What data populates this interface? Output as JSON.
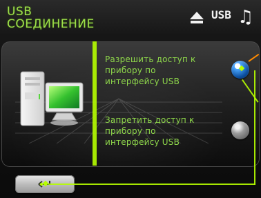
{
  "header": {
    "title_line1": "USB",
    "title_line2": "СОЕДИНЕНИЕ",
    "icons": [
      "eject-icon",
      "usb-icon",
      "music-note-icon"
    ],
    "usb_label": "USB"
  },
  "main": {
    "options": [
      {
        "label": "Разрешить доступ к прибору по интерфейсу USB",
        "lines": [
          "Разрешить доступ к",
          "прибору по",
          "интерфейсу USB"
        ],
        "selected": true
      },
      {
        "label": "Запретить доступ к прибору по интерфейсу USB",
        "lines": [
          "Запретить доступ к",
          "прибору по",
          "интерфейсу USB"
        ],
        "selected": false
      }
    ]
  },
  "footer": {
    "back_icon": "back-enter-icon"
  },
  "colors": {
    "title": "#9ee04a",
    "accent": "#b6ff00",
    "radio_selected": "#2b7ee0",
    "radio_unselected": "#8c8c8c",
    "text": "#8fd84b"
  }
}
